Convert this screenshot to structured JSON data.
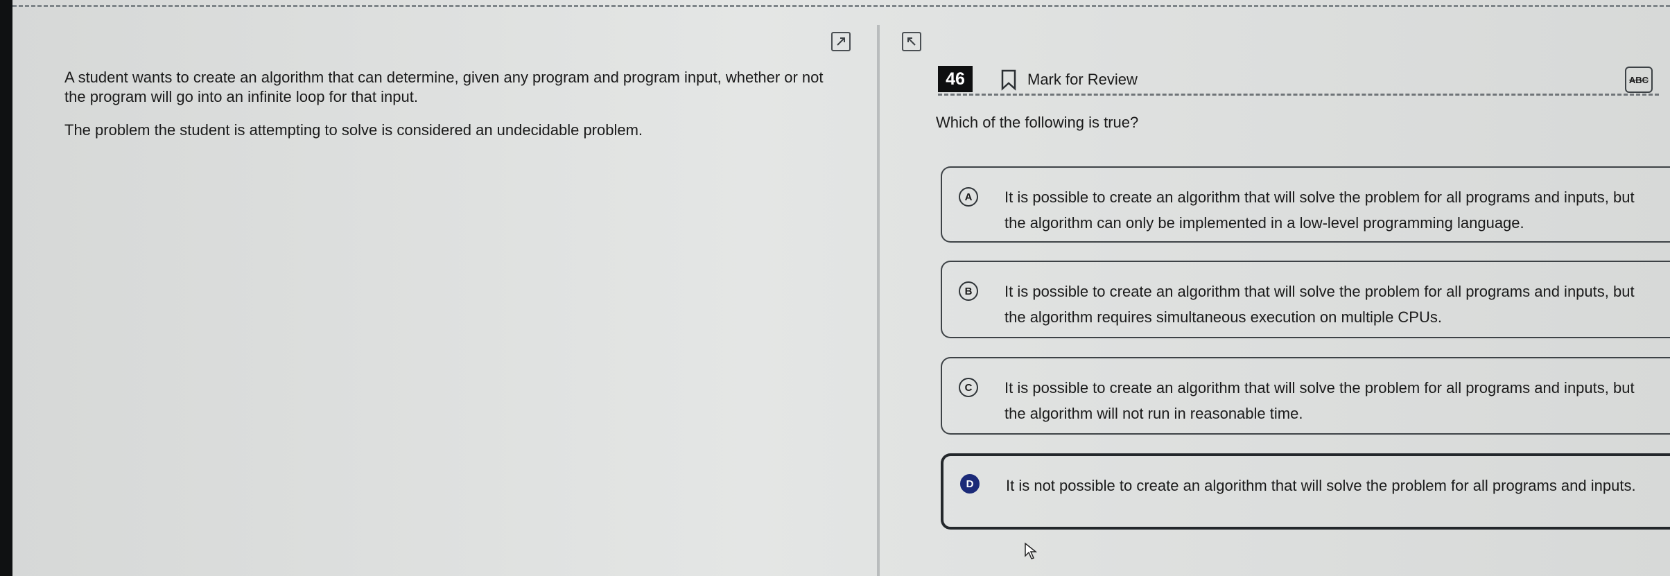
{
  "toolbar": {
    "left_expand_icon": "expand-diagonal-icon",
    "right_expand_icon": "collapse-diagonal-icon"
  },
  "passage": {
    "paragraph_1": "A student wants to create an algorithm that can determine, given any program and program input, whether or not the program will go into an infinite loop for that input.",
    "paragraph_2": "The problem the student is attempting to solve is considered an undecidable problem."
  },
  "question": {
    "number": "46",
    "mark_for_review_label": "Mark for Review",
    "bookmark_icon": "bookmark-icon",
    "abc_label": "ABC",
    "prompt": "Which of the following is true?",
    "selected": "D",
    "choices": [
      {
        "letter": "A",
        "text": "It is possible to create an algorithm that will solve the problem for all programs and inputs, but the algorithm can only be implemented in a low-level programming language."
      },
      {
        "letter": "B",
        "text": "It is possible to create an algorithm that will solve the problem for all programs and inputs, but the algorithm requires simultaneous execution on multiple CPUs."
      },
      {
        "letter": "C",
        "text": "It is possible to create an algorithm that will solve the problem for all programs and inputs, but the algorithm will not run in reasonable time."
      },
      {
        "letter": "D",
        "text": "It is not possible to create an algorithm that will solve the problem for all programs and inputs."
      }
    ]
  },
  "colors": {
    "selected_letter_bg": "#1b2a78",
    "question_number_bg": "#0e0f10"
  }
}
